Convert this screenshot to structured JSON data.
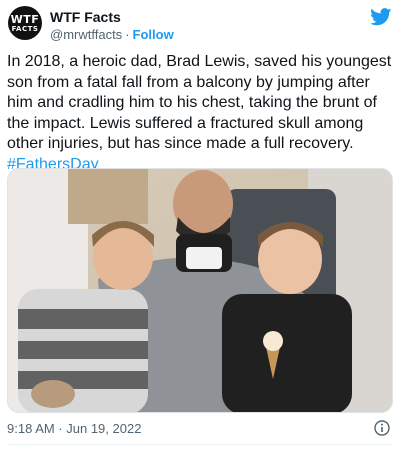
{
  "account": {
    "name": "WTF Facts",
    "handle": "@mrwtffacts",
    "separator": "·",
    "follow_label": "Follow",
    "avatar_line1": "WTF",
    "avatar_line2": "FACTS"
  },
  "tweet": {
    "text": "In 2018, a heroic dad, Brad Lewis, saved his youngest son from a fatal fall from a balcony by jumping after him and cradling him to his chest, taking the brunt of the impact. Lewis suffered a fractured skull among other injuries, but has since made a full recovery.",
    "hashtag": "#FathersDay",
    "timestamp": "9:18 AM · Jun 19, 2022"
  },
  "icons": {
    "platform": "bird-logo-icon",
    "info": "info-icon"
  },
  "colors": {
    "accent": "#1d9bf0",
    "text": "#0f1419",
    "muted": "#536471"
  }
}
